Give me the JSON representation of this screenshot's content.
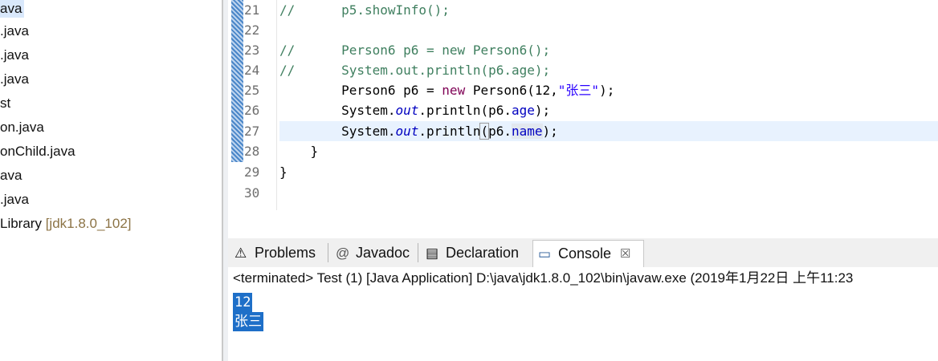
{
  "explorer": {
    "items": [
      {
        "label": "ava",
        "decoration": "",
        "selected": true
      },
      {
        "label": ".java",
        "decoration": ""
      },
      {
        "label": ".java",
        "decoration": ""
      },
      {
        "label": ".java",
        "decoration": ""
      },
      {
        "label": "st",
        "decoration": ""
      },
      {
        "label": "on.java",
        "decoration": ""
      },
      {
        "label": "onChild.java",
        "decoration": ""
      },
      {
        "label": "ava",
        "decoration": ""
      },
      {
        "label": ".java",
        "decoration": ""
      },
      {
        "label": "Library",
        "decoration": "[jdk1.8.0_102]"
      }
    ]
  },
  "editor": {
    "lines": [
      {
        "num": "21",
        "comment": "//",
        "code": "      p5.showInfo();"
      },
      {
        "num": "22"
      },
      {
        "num": "23",
        "comment": "//",
        "code": "      Person6 p6 = new Person6();"
      },
      {
        "num": "24",
        "comment": "//",
        "code": "      System.out.println(p6.age);"
      },
      {
        "num": "25",
        "indent": "        ",
        "type": "Person6",
        "var": " p6 = ",
        "kw": "new",
        "ctor": " Person6(12,",
        "str": "\"张三\"",
        "end": ");"
      },
      {
        "num": "26",
        "indent": "        ",
        "pre": "System.",
        "static": "out",
        "mid": ".println(p6.",
        "field": "age",
        "end": ");"
      },
      {
        "num": "27",
        "indent": "        ",
        "pre": "System.",
        "static": "out",
        "mid": ".println",
        "paren": "(",
        "arg": "p6.",
        "field": "name",
        "end": ");"
      },
      {
        "num": "28",
        "code": "    }"
      },
      {
        "num": "29",
        "code": "}"
      },
      {
        "num": "30",
        "code": ""
      }
    ],
    "scroll_arrow": "<"
  },
  "views": {
    "tabs": [
      {
        "label": "Problems",
        "icon": "problems-icon"
      },
      {
        "label": "Javadoc",
        "icon": "javadoc-icon"
      },
      {
        "label": "Declaration",
        "icon": "declaration-icon"
      },
      {
        "label": "Console",
        "icon": "console-icon",
        "active": true
      }
    ],
    "console_close": "☒"
  },
  "console": {
    "header": "<terminated> Test (1) [Java Application] D:\\java\\jdk1.8.0_102\\bin\\javaw.exe (2019年1月22日 上午11:23",
    "output": [
      "12",
      "张三"
    ]
  }
}
